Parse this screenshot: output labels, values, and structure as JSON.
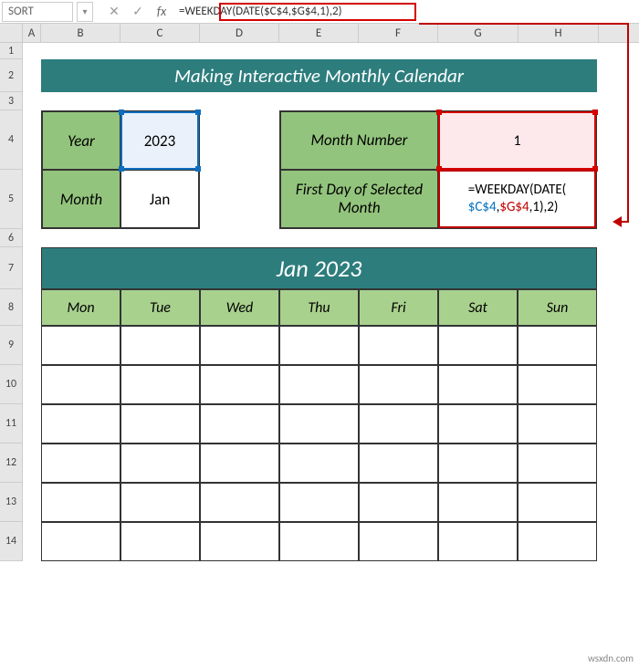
{
  "formula_bar": {
    "name_box": "SORT",
    "formula": "=WEEKDAY(DATE($C$4,$G$4,1),2)"
  },
  "columns": [
    "A",
    "B",
    "C",
    "D",
    "E",
    "F",
    "G",
    "H"
  ],
  "rows": [
    "1",
    "2",
    "3",
    "4",
    "5",
    "6",
    "7",
    "8",
    "9",
    "10",
    "11",
    "12",
    "13",
    "14"
  ],
  "title": "Making Interactive Monthly Calendar",
  "year_label": "Year",
  "year_value": "2023",
  "month_label": "Month",
  "month_value": "Jan",
  "month_number_label": "Month Number",
  "month_number_value": "1",
  "first_day_label": "First Day of Selected Month",
  "formula_cell": {
    "prefix": "=WEEKDAY(DATE(",
    "ref1": "$C$4",
    "comma1": ",",
    "ref2": "$G$4",
    "suffix": ",1),2)"
  },
  "calendar": {
    "title": "Jan 2023",
    "days": [
      "Mon",
      "Tue",
      "Wed",
      "Thu",
      "Fri",
      "Sat",
      "Sun"
    ]
  },
  "watermark": "wsxdn.com"
}
